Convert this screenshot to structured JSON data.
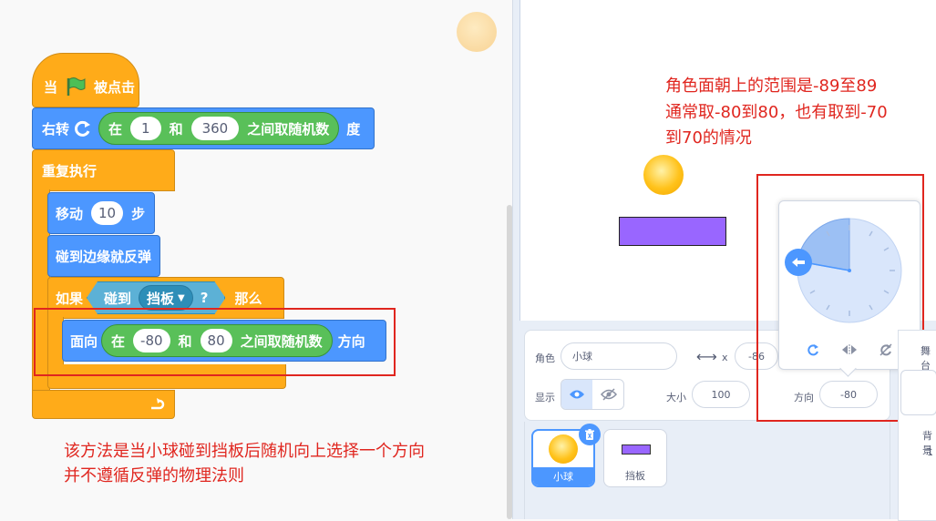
{
  "blocks": {
    "hat": {
      "when": "当",
      "clicked": "被点击"
    },
    "turn": {
      "label": "右转",
      "rand_in": "在",
      "rand_min": "1",
      "rand_and": "和",
      "rand_max": "360",
      "rand_suffix": "之间取随机数",
      "unit": "度"
    },
    "forever": {
      "label": "重复执行"
    },
    "move": {
      "label": "移动",
      "steps": "10",
      "unit": "步"
    },
    "bounce": {
      "label": "碰到边缘就反弹"
    },
    "if_block": {
      "if": "如果",
      "touching": "碰到",
      "target": "挡板",
      "question": "?",
      "then": "那么"
    },
    "point": {
      "label": "面向",
      "rand_in": "在",
      "rand_min": "-80",
      "rand_and": "和",
      "rand_max": "80",
      "rand_suffix": "之间取随机数",
      "suffix": "方向"
    }
  },
  "annotations": {
    "bottom_line1": "该方法是当小球碰到挡板后随机向上选择一个方向",
    "bottom_line2": "并不遵循反弹的物理法则",
    "top_line1": "角色面朝上的范围是-89至89",
    "top_line2": "通常取-80到80，也有取到-70",
    "top_line3": "到70的情况"
  },
  "sprite_info": {
    "sprite_label": "角色",
    "sprite_name": "小球",
    "x_label": "x",
    "x_value": "-86",
    "show_label": "显示",
    "size_label": "大小",
    "size_value": "100",
    "direction_label": "方向",
    "direction_value": "-80"
  },
  "sprites": [
    {
      "name": "小球",
      "selected": true
    },
    {
      "name": "挡板",
      "selected": false
    }
  ],
  "backdrop": {
    "label_top": "舞台",
    "label_mid": "背景",
    "count": "1"
  },
  "colors": {
    "events": "#ffab19",
    "motion": "#4c97ff",
    "operators": "#59c059",
    "sensing": "#5cb1d6",
    "annotation": "#e0261f",
    "paddle": "#9966ff"
  }
}
